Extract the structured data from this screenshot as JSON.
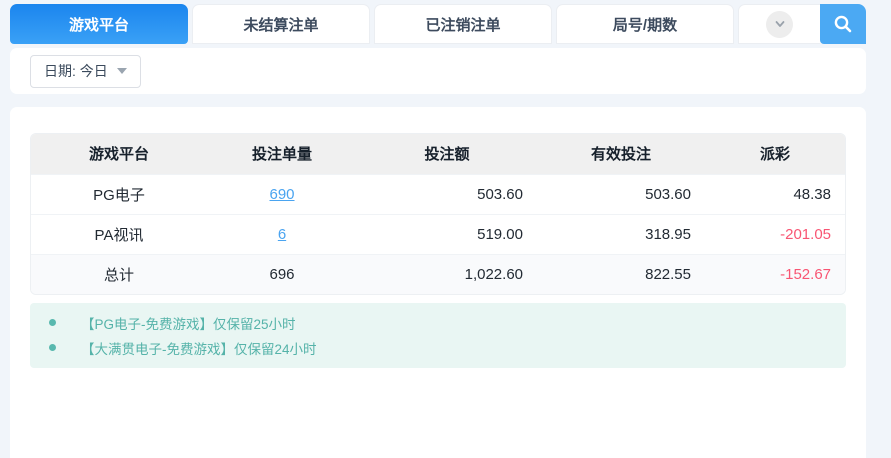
{
  "tabs": [
    {
      "label": "游戏平台",
      "active": true
    },
    {
      "label": "未结算注单",
      "active": false
    },
    {
      "label": "已注销注单",
      "active": false
    },
    {
      "label": "局号/期数",
      "active": false
    }
  ],
  "filter": {
    "date_label": "日期: 今日"
  },
  "table": {
    "headers": [
      "游戏平台",
      "投注单量",
      "投注额",
      "有效投注",
      "派彩"
    ],
    "rows": [
      {
        "platform": "PG电子",
        "bet_count": "690",
        "bet_amount": "503.60",
        "valid_bet": "503.60",
        "payout": "48.38"
      },
      {
        "platform": "PA视讯",
        "bet_count": "6",
        "bet_amount": "519.00",
        "valid_bet": "318.95",
        "payout": "-201.05"
      }
    ],
    "total": {
      "platform": "总计",
      "bet_count": "696",
      "bet_amount": "1,022.60",
      "valid_bet": "822.55",
      "payout": "-152.67"
    }
  },
  "notes": [
    "【PG电子-免费游戏】仅保留25小时",
    "【大满贯电子-免费游戏】仅保留24小时"
  ],
  "colors": {
    "accent_blue": "#2e9af3",
    "search_button_blue": "#4ba9f3",
    "link_blue": "#4aa4f0",
    "negative_red": "#f85573",
    "note_teal": "#55b3a9"
  }
}
